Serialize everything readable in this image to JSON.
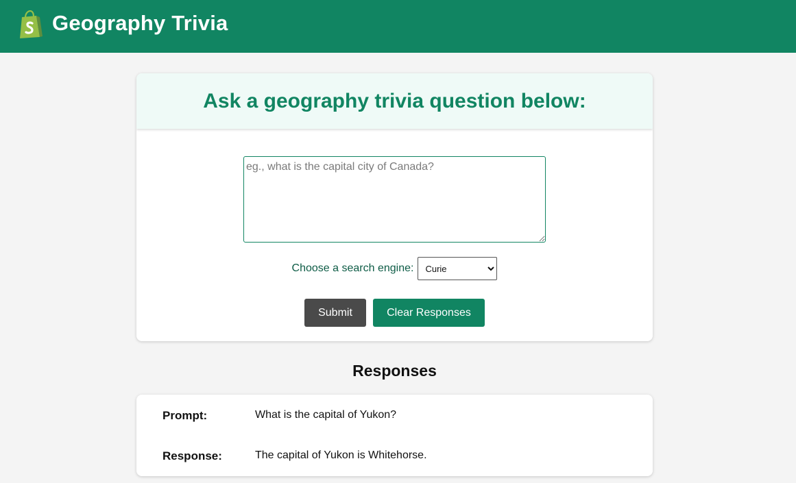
{
  "header": {
    "title": "Geography Trivia",
    "logo_icon": "shopping-bag-logo-icon",
    "background": "#118562"
  },
  "form": {
    "heading": "Ask a geography trivia question below:",
    "question_value": "",
    "question_placeholder": "eg., what is the capital city of Canada?",
    "engine_label": "Choose a search engine:",
    "engine_selected": "Curie",
    "submit_label": "Submit",
    "clear_label": "Clear Responses"
  },
  "responses": {
    "title": "Responses",
    "items": [
      {
        "prompt_label": "Prompt:",
        "prompt": "What is the capital of Yukon?",
        "response_label": "Response:",
        "response": "The capital of Yukon is Whitehorse."
      }
    ]
  },
  "colors": {
    "accent": "#118562",
    "header_panel": "#effaf7",
    "submit_button": "#4a4a4a",
    "page_background": "#f4f4f4"
  }
}
